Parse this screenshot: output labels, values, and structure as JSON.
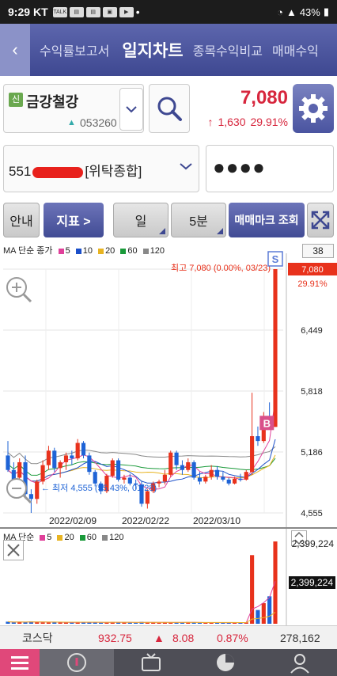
{
  "status_bar": {
    "time": "9:29",
    "carrier": "KT",
    "icons": [
      "talk-icon",
      "news-icon",
      "news-icon",
      "image-icon",
      "youtube-icon"
    ],
    "battery": "43%",
    "more": "•"
  },
  "tabs": {
    "items": [
      "수익률보고서",
      "일지차트",
      "종목수익비교",
      "매매수익"
    ],
    "active_index": 1
  },
  "stock": {
    "badge": "신",
    "name": "금강철강",
    "code": "053260",
    "price": "7,080",
    "change": "1,630",
    "change_pct": "29.91%",
    "direction": "up"
  },
  "account": {
    "number_prefix": "551",
    "name": "[위탁종합]",
    "password_mask": "●●●●"
  },
  "controls": {
    "guide": "안내",
    "indicator": "지표 >",
    "period": "일",
    "interval": "5분",
    "trade_mark": "매매마크 조회"
  },
  "chart_header": {
    "ma_label": "MA 단순 종가",
    "ma_periods": [
      "5",
      "10",
      "20",
      "60",
      "120"
    ],
    "ma_colors": [
      "#e0409a",
      "#1b4fc9",
      "#e8b422",
      "#1a9a3a",
      "#888888"
    ],
    "view_count": "38"
  },
  "chart": {
    "y_ticks": [
      "7,080",
      "6,449",
      "5,818",
      "5,186",
      "4,555"
    ],
    "current_pct": "29.91%",
    "high_label": "최고 7,080 (0.00%, 03/23)",
    "low_label": "최저 4,555 (55.43%, 01/28)",
    "x_labels": [
      "2022/02/09",
      "2022/02/22",
      "2022/03/10"
    ],
    "marker_sell": "S",
    "marker_buy": "B",
    "up_color": "#e8321c",
    "down_color": "#1e63d6"
  },
  "chart_data": {
    "type": "candlestick",
    "ylim": [
      4555,
      7080
    ],
    "candles": [
      {
        "o": 5150,
        "h": 5300,
        "l": 4980,
        "c": 5000
      },
      {
        "o": 5000,
        "h": 5080,
        "l": 4800,
        "c": 4900
      },
      {
        "o": 4920,
        "h": 5120,
        "l": 4880,
        "c": 5080
      },
      {
        "o": 5080,
        "h": 5150,
        "l": 4700,
        "c": 4750
      },
      {
        "o": 4750,
        "h": 4800,
        "l": 4555,
        "c": 4700
      },
      {
        "o": 4700,
        "h": 4900,
        "l": 4650,
        "c": 4880
      },
      {
        "o": 4880,
        "h": 5100,
        "l": 4850,
        "c": 5050
      },
      {
        "o": 5050,
        "h": 5250,
        "l": 5000,
        "c": 5200
      },
      {
        "o": 5200,
        "h": 5230,
        "l": 4980,
        "c": 5020
      },
      {
        "o": 5020,
        "h": 5100,
        "l": 4920,
        "c": 5080
      },
      {
        "o": 5080,
        "h": 5180,
        "l": 5000,
        "c": 5150
      },
      {
        "o": 5150,
        "h": 5200,
        "l": 5050,
        "c": 5120
      },
      {
        "o": 5120,
        "h": 5320,
        "l": 5100,
        "c": 5280
      },
      {
        "o": 5280,
        "h": 5300,
        "l": 5120,
        "c": 5150
      },
      {
        "o": 5150,
        "h": 5180,
        "l": 4950,
        "c": 4980
      },
      {
        "o": 4980,
        "h": 5000,
        "l": 4830,
        "c": 4860
      },
      {
        "o": 4860,
        "h": 4880,
        "l": 4750,
        "c": 4780
      },
      {
        "o": 4780,
        "h": 4960,
        "l": 4760,
        "c": 4940
      },
      {
        "o": 4940,
        "h": 5120,
        "l": 4920,
        "c": 5100
      },
      {
        "o": 5100,
        "h": 5120,
        "l": 4880,
        "c": 4900
      },
      {
        "o": 4900,
        "h": 4950,
        "l": 4860,
        "c": 4920
      },
      {
        "o": 4920,
        "h": 4960,
        "l": 4840,
        "c": 4860
      },
      {
        "o": 4860,
        "h": 4900,
        "l": 4800,
        "c": 4850
      },
      {
        "o": 4850,
        "h": 4880,
        "l": 4620,
        "c": 4650
      },
      {
        "o": 4650,
        "h": 4800,
        "l": 4600,
        "c": 4780
      },
      {
        "o": 4780,
        "h": 4880,
        "l": 4760,
        "c": 4860
      },
      {
        "o": 4860,
        "h": 4900,
        "l": 4820,
        "c": 4880
      },
      {
        "o": 4880,
        "h": 5000,
        "l": 4850,
        "c": 4950
      },
      {
        "o": 4950,
        "h": 5200,
        "l": 4930,
        "c": 5180
      },
      {
        "o": 5180,
        "h": 5200,
        "l": 5000,
        "c": 5050
      },
      {
        "o": 5050,
        "h": 5100,
        "l": 4950,
        "c": 5000
      },
      {
        "o": 5000,
        "h": 5120,
        "l": 4980,
        "c": 5080
      },
      {
        "o": 5080,
        "h": 5100,
        "l": 4900,
        "c": 4920
      },
      {
        "o": 4920,
        "h": 4980,
        "l": 4850,
        "c": 4880
      },
      {
        "o": 4880,
        "h": 4950,
        "l": 4860,
        "c": 4930
      },
      {
        "o": 4930,
        "h": 5050,
        "l": 4900,
        "c": 5000
      },
      {
        "o": 5000,
        "h": 5040,
        "l": 4900,
        "c": 4930
      },
      {
        "o": 4930,
        "h": 4980,
        "l": 4880,
        "c": 4900
      },
      {
        "o": 4900,
        "h": 4920,
        "l": 4840,
        "c": 4860
      },
      {
        "o": 4860,
        "h": 4930,
        "l": 4850,
        "c": 4910
      },
      {
        "o": 4910,
        "h": 4960,
        "l": 4880,
        "c": 4900
      },
      {
        "o": 4900,
        "h": 5000,
        "l": 4890,
        "c": 4980
      },
      {
        "o": 4980,
        "h": 5800,
        "l": 4950,
        "c": 5350
      },
      {
        "o": 5350,
        "h": 5450,
        "l": 5250,
        "c": 5300
      },
      {
        "o": 5300,
        "h": 5600,
        "l": 5280,
        "c": 5450
      },
      {
        "o": 5450,
        "h": 5700,
        "l": 5430,
        "c": 5446
      },
      {
        "o": 5446,
        "h": 7080,
        "l": 5446,
        "c": 7080
      }
    ]
  },
  "volume": {
    "ma_label": "MA 단순",
    "ma_periods": [
      "5",
      "20",
      "60",
      "120"
    ],
    "ma_colors": [
      "#e0409a",
      "#e8b422",
      "#1a9a3a",
      "#888888"
    ],
    "max_label": "2,399,224",
    "current_label": "2,399,224",
    "values": [
      60,
      40,
      55,
      45,
      70,
      50,
      40,
      35,
      45,
      40,
      35,
      38,
      50,
      42,
      40,
      35,
      30,
      45,
      50,
      38,
      35,
      32,
      30,
      55,
      45,
      35,
      30,
      38,
      45,
      40,
      35,
      38,
      42,
      30,
      32,
      35,
      38,
      30,
      28,
      30,
      32,
      40,
      2000,
      400,
      600,
      800,
      2399
    ]
  },
  "index_bar": {
    "name": "코스닥",
    "value": "932.75",
    "change": "8.08",
    "change_pct": "0.87%",
    "volume": "278,162"
  },
  "bottom_nav": {
    "items": [
      "menu-icon",
      "chart-icon",
      "tv-icon",
      "pie-icon",
      "person-icon"
    ]
  }
}
